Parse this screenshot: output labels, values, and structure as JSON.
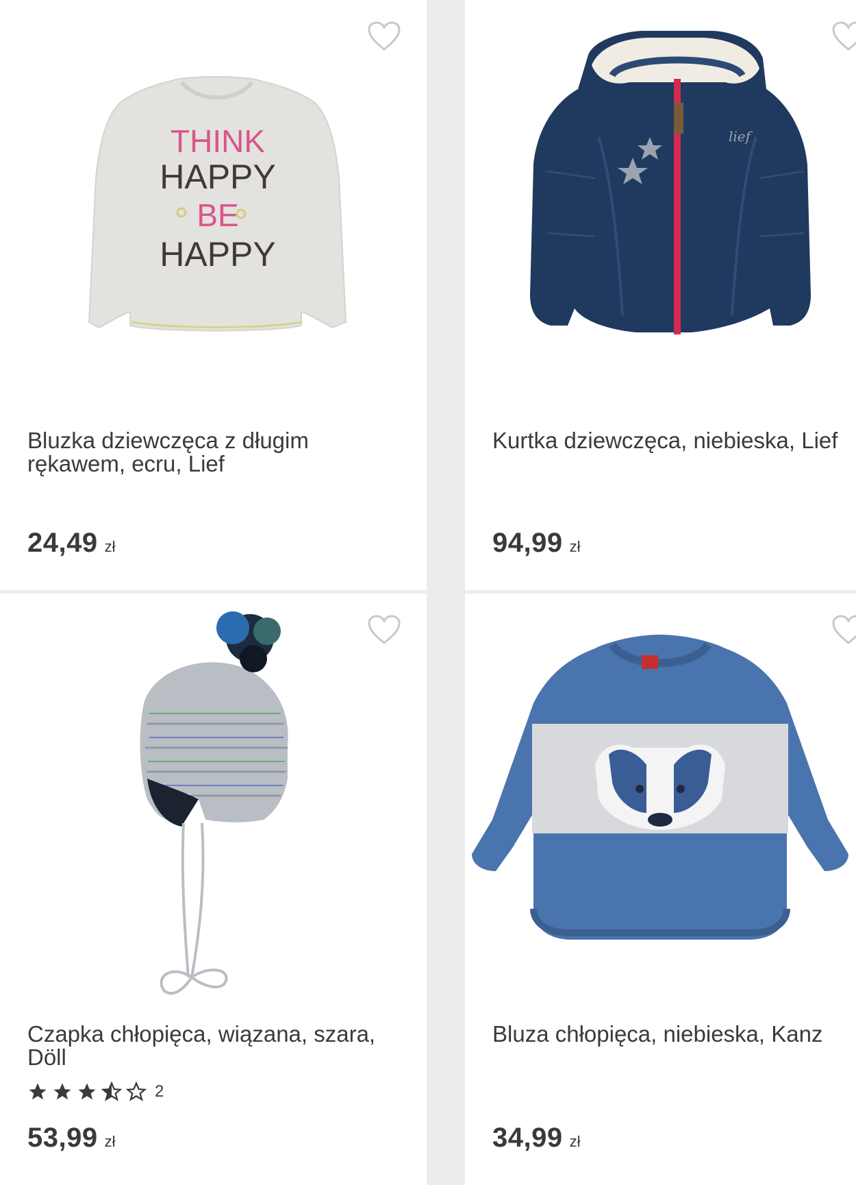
{
  "products": [
    {
      "title": "Bluzka dziewczęca z długim rękawem, ecru, Lief",
      "price": "24,49",
      "currency": "zł",
      "image": "long-sleeve-shirt-think-happy",
      "shirt_text": [
        "THINK",
        "HAPPY",
        "BE",
        "HAPPY"
      ]
    },
    {
      "title": "Kurtka dziewczęca, niebieska, Lief",
      "price": "94,99",
      "currency": "zł",
      "image": "navy-puffer-jacket"
    },
    {
      "title": "Czapka chłopięca, wiązana, szara, Döll",
      "price": "53,99",
      "currency": "zł",
      "image": "knit-pompom-hat",
      "rating": 3.5,
      "rating_max": 5,
      "rating_count": "2"
    },
    {
      "title": "Bluza chłopięca, niebieska, Kanz",
      "price": "34,99",
      "currency": "zł",
      "image": "blue-badger-sweatshirt"
    }
  ],
  "icons": {
    "favorite": "heart-outline-icon",
    "star_full": "star-filled-icon",
    "star_half": "star-half-icon",
    "star_empty": "star-outline-icon"
  },
  "colors": {
    "text": "#3a3a3a",
    "background": "#ececec",
    "card": "#ffffff",
    "heart": "#c8c8c8"
  }
}
